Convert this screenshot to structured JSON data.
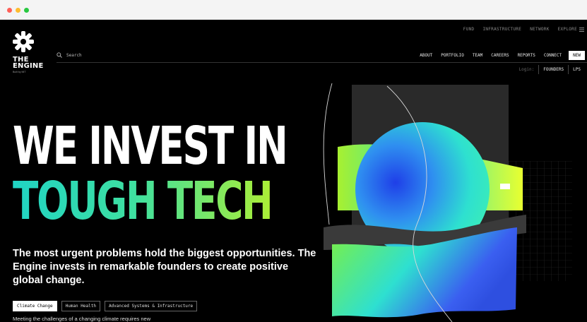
{
  "brand": {
    "line1": "THE",
    "line2": "ENGINE",
    "sub": "Built by MIT"
  },
  "utility_nav": [
    "FUND",
    "INFRASTRUCTURE",
    "NETWORK"
  ],
  "explore_label": "EXPLORE",
  "search": {
    "label": "Search"
  },
  "main_nav": [
    "ABOUT",
    "PORTFOLIO",
    "TEAM",
    "CAREERS",
    "REPORTS",
    "CONNECT"
  ],
  "new_button": "NEW",
  "login": {
    "label": "Login:",
    "founders": "FOUNDERS",
    "lps": "LPS"
  },
  "hero": {
    "line1": "WE INVEST IN",
    "line2": "TOUGH TECH",
    "tagline": "The most urgent problems hold the biggest opportunities. The Engine invests in remarkable founders to create positive global change."
  },
  "chips": [
    "Climate Change",
    "Human Health",
    "Advanced Systems & Infrastructure"
  ],
  "footnote": "Meeting the challenges of a changing climate requires new",
  "colors": {
    "background": "#000000",
    "accent_teal": "#20d4c4",
    "accent_lime": "#b8f02a"
  }
}
